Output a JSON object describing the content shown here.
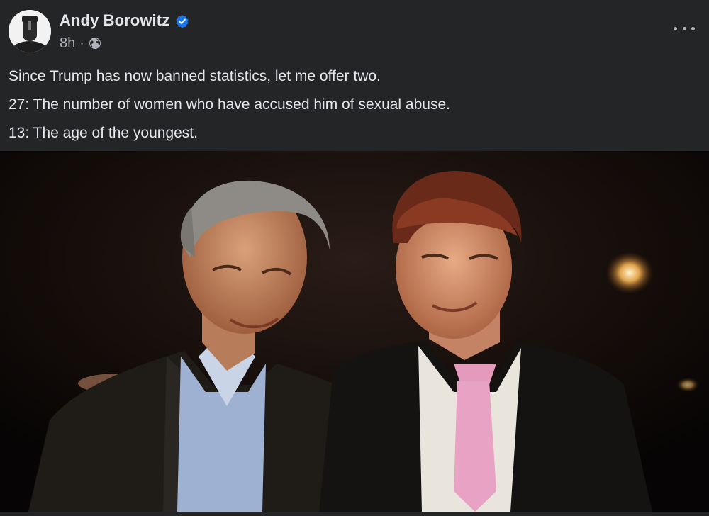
{
  "post": {
    "author": "Andy Borowitz",
    "verified": true,
    "timestamp": "8h",
    "separator": "·",
    "audience_icon": "globe-icon",
    "more_icon": "more-options-icon",
    "text_lines": [
      "Since Trump has now banned statistics, let me offer two.",
      "27: The number of women who have accused him of sexual abuse.",
      "13: The age of the youngest."
    ]
  },
  "colors": {
    "background": "#242526",
    "primary_text": "#e4e6eb",
    "secondary_text": "#b0b3b8",
    "verified_badge": "#1877f2"
  }
}
